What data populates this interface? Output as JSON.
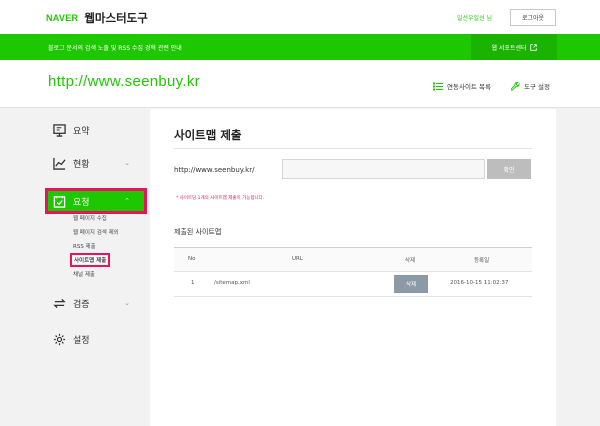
{
  "header": {
    "naver_logo": "NAVER",
    "app_title": "웹마스터도구",
    "user_label": "일선우일선 님",
    "logout_label": "로그아웃"
  },
  "notice_bar": {
    "text": "블로그 문서의 검색 노출 및 RSS 수집 경혁 관련 안내",
    "support_label": "웹 서포트센터",
    "support_icon": "external-link-icon",
    "bg_color": "#1ec800"
  },
  "site": {
    "url": "http://www.seenbuy.kr",
    "linked_sites_label": "연동사이트 목록",
    "tool_settings_label": "도구 설정"
  },
  "sidebar": {
    "items": [
      {
        "label": "요약",
        "icon": "summary-icon"
      },
      {
        "label": "현황",
        "icon": "chart-icon"
      },
      {
        "label": "요청",
        "icon": "request-icon",
        "active": true
      },
      {
        "label": "검증",
        "icon": "verify-icon"
      },
      {
        "label": "설정",
        "icon": "gear-icon"
      }
    ],
    "sub_items": [
      "웹 페이지 수집",
      "웹 페이지 검색 제외",
      "RSS 제출",
      "사이트맵 제출",
      "채널 제출"
    ],
    "highlight_color": "#e6135e"
  },
  "main": {
    "title": "사이트맵 제출",
    "url_prefix": "http://www.seenbuy.kr/",
    "input_value": "",
    "confirm_label": "확인",
    "hint": "* 사이트당 1개의 사이트맵 제출이 가능합니다.",
    "section_title": "제출된 사이트맵",
    "table": {
      "headers": [
        "No",
        "URL",
        "삭제",
        "등록일"
      ],
      "rows": [
        {
          "no": "1",
          "url": "/sitemap.xml",
          "delete": "삭제",
          "date": "2016-10-15 11:02:37"
        }
      ]
    }
  }
}
